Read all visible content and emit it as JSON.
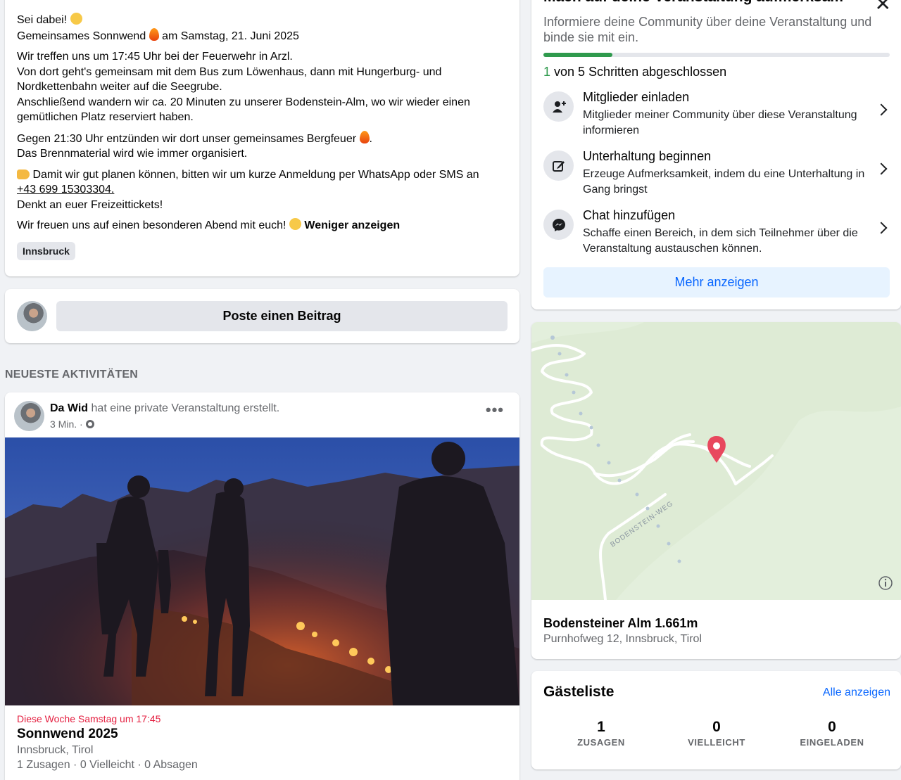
{
  "description": {
    "lines": [
      "Sei dabei!",
      "Gemeinsames Sonnwend",
      "am Samstag, 21. Juni 2025",
      "Wir treffen uns um 17:45 Uhr bei der Feuerwehr in Arzl.",
      "Von dort geht's gemeinsam mit dem Bus zum Löwenhaus, dann mit Hungerburg- und Nordkettenbahn weiter auf die Seegrube.",
      "Anschließend wandern wir ca. 20 Minuten zu unserer Bodenstein-Alm, wo wir wieder einen gemütlichen Platz reserviert haben.",
      "Gegen 21:30 Uhr entzünden wir dort unser gemeinsames Bergfeuer",
      "Das Brennmaterial wird wie immer organisiert.",
      "Damit wir gut planen können, bitten wir um kurze Anmeldung per WhatsApp oder SMS an",
      "+43 699 15303304.",
      "Denkt an euer Freizeittickets!",
      "Wir freuen uns auf einen besonderen Abend mit euch!"
    ],
    "less_link": "Weniger anzeigen",
    "tag": "Innsbruck"
  },
  "composer": {
    "button_label": "Poste einen Beitrag"
  },
  "activity": {
    "heading": "NEUESTE AKTIVITÄTEN",
    "author": "Da Wid",
    "action": "hat eine private Veranstaltung erstellt.",
    "time": "3 Min. ·",
    "more_icon": "more-horizontal-icon",
    "event_date": "Diese Woche Samstag um 17:45",
    "event_title": "Sonnwend 2025",
    "event_location": "Innsbruck, Tirol",
    "event_stats": "1 Zusagen · 0 Vielleicht · 0 Absagen"
  },
  "promo": {
    "title": "Mach auf deine Veranstaltung aufmerksam",
    "subtitle": "Informiere deine Community über deine Veranstaltung und binde sie mit ein.",
    "progress_fraction": 0.2,
    "steps_done": "1",
    "steps_text": " von 5 Schritten abgeschlossen",
    "steps": [
      {
        "title": "Mitglieder einladen",
        "desc": "Mitglieder meiner Community über diese Veranstaltung informieren",
        "icon": "add-person-icon"
      },
      {
        "title": "Unterhaltung beginnen",
        "desc": "Erzeuge Aufmerksamkeit, indem du eine Unterhaltung in Gang bringst",
        "icon": "edit-icon"
      },
      {
        "title": "Chat hinzufügen",
        "desc": "Schaffe einen Bereich, in dem sich Teilnehmer über die Veranstaltung austauschen können.",
        "icon": "messenger-icon"
      }
    ],
    "more_button": "Mehr anzeigen"
  },
  "map": {
    "road_label": "BODENSTEIN-WEG",
    "place_name": "Bodensteiner Alm 1.661m",
    "place_address": "Purnhofweg 12, Innsbruck, Tirol"
  },
  "guests": {
    "title": "Gästeliste",
    "all_link": "Alle anzeigen",
    "counts": [
      {
        "value": "1",
        "label": "ZUSAGEN"
      },
      {
        "value": "0",
        "label": "VIELLEICHT"
      },
      {
        "value": "0",
        "label": "EINGELADEN"
      }
    ]
  },
  "colors": {
    "accent": "#0866ff",
    "success": "#2f9a4d",
    "date_red": "#e41e3f",
    "map_green": "#e3efdc"
  }
}
